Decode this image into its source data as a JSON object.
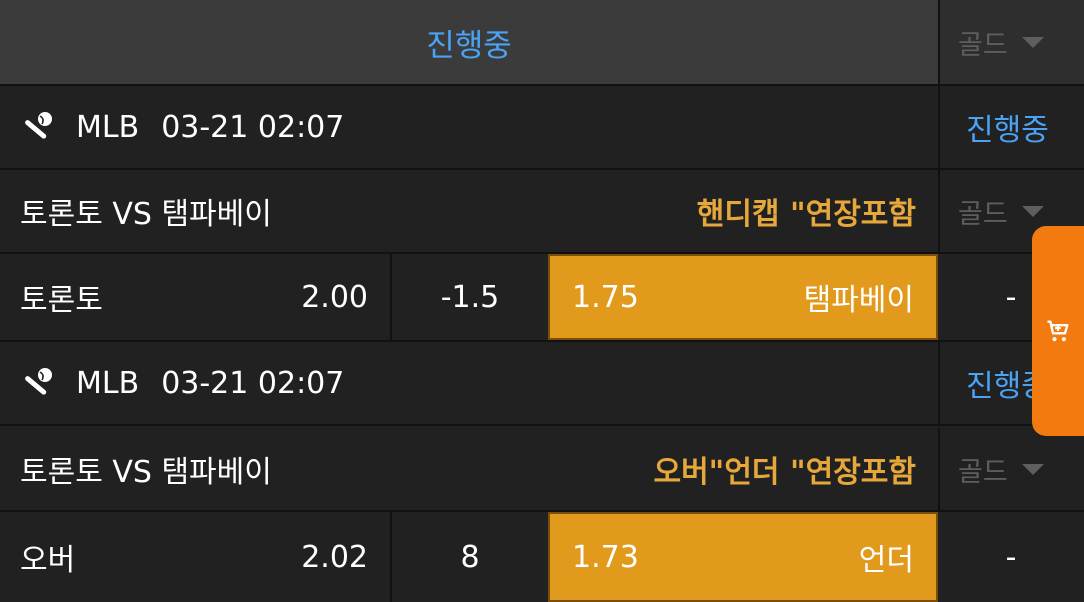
{
  "header": {
    "status_label": "진행중",
    "filter_label": "골드"
  },
  "games": [
    {
      "league": "MLB",
      "datetime": "03-21 02:07",
      "status": "진행중",
      "teams": "토론토 VS 탬파베이",
      "bet_type": "핸디캡 \"연장포함",
      "gold_label": "골드",
      "home_label": "토론토",
      "home_odds": "2.00",
      "line": "-1.5",
      "away_odds": "1.75",
      "away_label": "탬파베이",
      "draw": "-"
    },
    {
      "league": "MLB",
      "datetime": "03-21 02:07",
      "status": "진행중",
      "teams": "토론토 VS 탬파베이",
      "bet_type": "오버\"언더 \"연장포함",
      "gold_label": "골드",
      "home_label": "오버",
      "home_odds": "2.02",
      "line": "8",
      "away_odds": "1.73",
      "away_label": "언더",
      "draw": "-"
    }
  ],
  "icons": {
    "sport": "baseball-bat-icon",
    "cart": "cart-icon",
    "dropdown": "caret-down-icon"
  },
  "colors": {
    "accent_blue": "#4aa3f4",
    "selected_odds": "#e29a1c",
    "bet_type_text": "#e6a83a",
    "cart_tab": "#f27a0e"
  }
}
